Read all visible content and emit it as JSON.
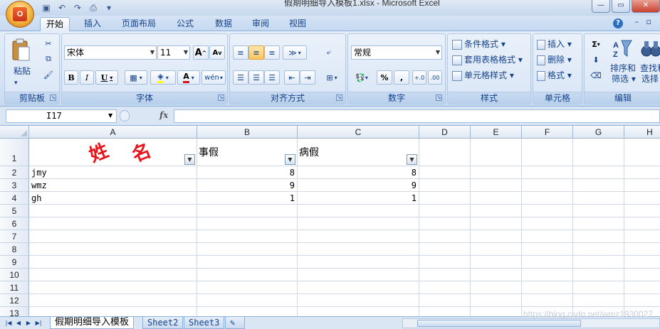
{
  "window": {
    "title": "假期明细导入模板1.xlsx - Microsoft Excel"
  },
  "ribbon_tabs": [
    "开始",
    "插入",
    "页面布局",
    "公式",
    "数据",
    "审阅",
    "视图"
  ],
  "clipboard": {
    "paste_label": "粘贴",
    "group_label": "剪贴板"
  },
  "font": {
    "family": "宋体",
    "size": "11",
    "group_label": "字体",
    "bold": "B",
    "italic": "I",
    "underline": "U",
    "grow": "A",
    "shrink": "A",
    "font_color": "A",
    "phonetic": "wén"
  },
  "alignment": {
    "group_label": "对齐方式"
  },
  "number": {
    "format": "常规",
    "group_label": "数字",
    "percent": "%",
    "comma": ","
  },
  "styles": {
    "conditional": "条件格式 ▾",
    "table": "套用表格格式 ▾",
    "cell_styles": "单元格样式 ▾",
    "group_label": "样式"
  },
  "cells": {
    "insert": "插入 ▾",
    "delete": "删除 ▾",
    "format": "格式 ▾",
    "group_label": "单元格"
  },
  "editing": {
    "sort_filter": "排序和\n筛选 ▾",
    "find_select": "查找和\n选择 ▾",
    "sort_line1": "排序和",
    "sort_line2": "筛选 ▾",
    "find_line1": "查找和",
    "find_line2": "选择 ▾",
    "group_label": "编辑",
    "sigma": "Σ"
  },
  "formula_bar": {
    "name_box": "I17",
    "fx": "fx",
    "formula": ""
  },
  "columns": [
    "A",
    "B",
    "C",
    "D",
    "E",
    "F",
    "G",
    "H"
  ],
  "rows": [
    "1",
    "2",
    "3",
    "4",
    "5",
    "6",
    "7",
    "8",
    "9",
    "10",
    "11",
    "12",
    "13"
  ],
  "sheet": {
    "header": {
      "a_decoration": "姓  名",
      "b": "事假",
      "c": "病假"
    },
    "data": [
      {
        "name": "jmy",
        "b": "8",
        "c": "8"
      },
      {
        "name": "wmz",
        "b": "9",
        "c": "9"
      },
      {
        "name": "gh",
        "b": "1",
        "c": "1"
      }
    ]
  },
  "sheet_tabs": [
    "假期明细导入模板",
    "Sheet2",
    "Sheet3"
  ],
  "watermark": "https://blog.csdn.net/wmz1930027"
}
